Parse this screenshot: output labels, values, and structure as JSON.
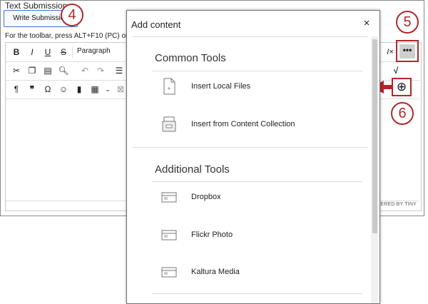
{
  "editor": {
    "section_title": "Text Submission",
    "write_button": "Write Submission",
    "toolbar_hint": "For the toolbar, press ALT+F10 (PC) or AL",
    "paragraph_label": "Paragraph",
    "powered_by": "WERED BY TINY"
  },
  "callouts": {
    "step4": "4",
    "step5": "5",
    "step6": "6",
    "color": "#b0282a"
  },
  "dialog": {
    "title": "Add content",
    "close_glyph": "×",
    "groups": [
      {
        "title": "Common Tools",
        "items": [
          {
            "label": "Insert Local Files",
            "icon": "file-icon"
          },
          {
            "label": "Insert from Content Collection",
            "icon": "content-collection-icon"
          }
        ]
      },
      {
        "title": "Additional Tools",
        "items": [
          {
            "label": "Dropbox",
            "icon": "window-icon"
          },
          {
            "label": "Flickr Photo",
            "icon": "window-icon"
          },
          {
            "label": "Kaltura Media",
            "icon": "window-icon"
          }
        ]
      }
    ]
  },
  "toolbar": {
    "row1": [
      "B",
      "I",
      "U",
      "S"
    ],
    "more_glyph": "•••",
    "plus_glyph": "⊕",
    "row1_right": "I×"
  }
}
